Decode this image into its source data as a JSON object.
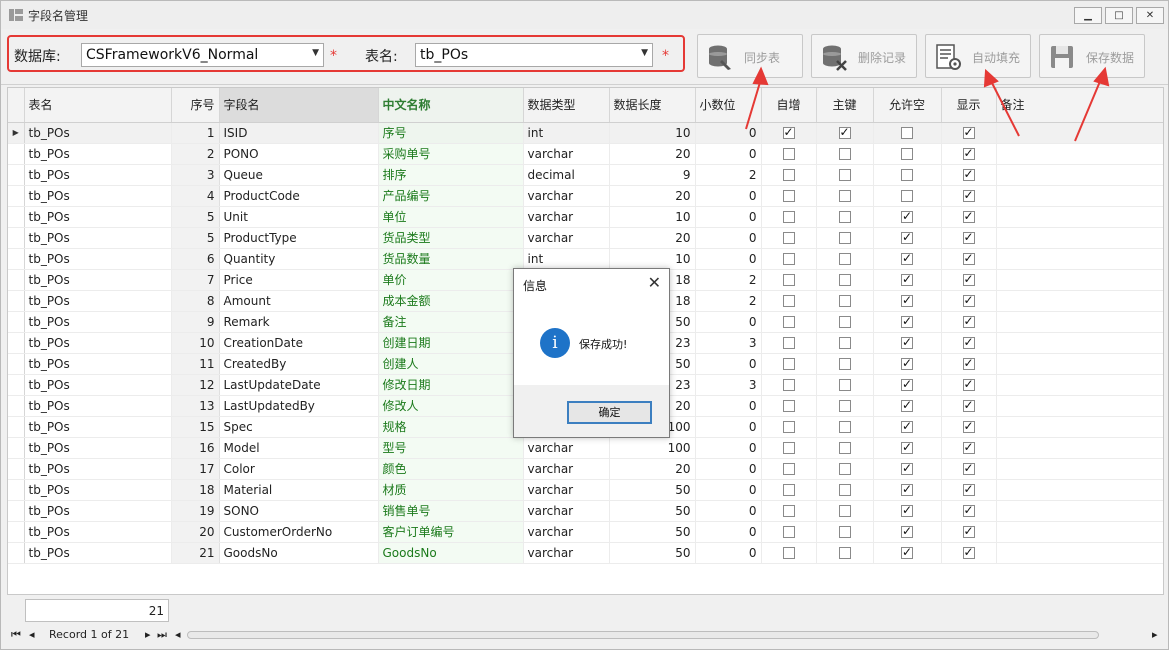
{
  "window": {
    "title": "字段名管理",
    "min_label": "▁",
    "max_label": "□",
    "close_label": "✕"
  },
  "toolbar": {
    "db_label": "数据库:",
    "db_value": "CSFrameworkV6_Normal",
    "table_label": "表名:",
    "table_value": "tb_POs",
    "required_mark": "*",
    "sync_label": "同步表",
    "delete_label": "删除记录",
    "autofill_label": "自动填充",
    "save_label": "保存数据"
  },
  "grid": {
    "headers": [
      "表名",
      "序号",
      "字段名",
      "中文名称",
      "数据类型",
      "数据长度",
      "小数位",
      "自增",
      "主键",
      "允许空",
      "显示",
      "备注"
    ],
    "rows": [
      {
        "table": "tb_POs",
        "no": 1,
        "field": "ISID",
        "cn": "序号",
        "type": "int",
        "len": 10,
        "dec": 0,
        "auto": true,
        "pk": true,
        "nullable": false,
        "show": true
      },
      {
        "table": "tb_POs",
        "no": 2,
        "field": "PONO",
        "cn": "采购单号",
        "type": "varchar",
        "len": 20,
        "dec": 0,
        "auto": false,
        "pk": false,
        "nullable": false,
        "show": true
      },
      {
        "table": "tb_POs",
        "no": 3,
        "field": "Queue",
        "cn": "排序",
        "type": "decimal",
        "len": 9,
        "dec": 2,
        "auto": false,
        "pk": false,
        "nullable": false,
        "show": true
      },
      {
        "table": "tb_POs",
        "no": 4,
        "field": "ProductCode",
        "cn": "产品编号",
        "type": "varchar",
        "len": 20,
        "dec": 0,
        "auto": false,
        "pk": false,
        "nullable": false,
        "show": true
      },
      {
        "table": "tb_POs",
        "no": 5,
        "field": "Unit",
        "cn": "单位",
        "type": "varchar",
        "len": 10,
        "dec": 0,
        "auto": false,
        "pk": false,
        "nullable": true,
        "show": true
      },
      {
        "table": "tb_POs",
        "no": 5,
        "field": "ProductType",
        "cn": "货品类型",
        "type": "varchar",
        "len": 20,
        "dec": 0,
        "auto": false,
        "pk": false,
        "nullable": true,
        "show": true
      },
      {
        "table": "tb_POs",
        "no": 6,
        "field": "Quantity",
        "cn": "货品数量",
        "type": "int",
        "len": 10,
        "dec": 0,
        "auto": false,
        "pk": false,
        "nullable": true,
        "show": true
      },
      {
        "table": "tb_POs",
        "no": 7,
        "field": "Price",
        "cn": "单价",
        "type": "",
        "len": 18,
        "dec": 2,
        "auto": false,
        "pk": false,
        "nullable": true,
        "show": true
      },
      {
        "table": "tb_POs",
        "no": 8,
        "field": "Amount",
        "cn": "成本金额",
        "type": "",
        "len": 18,
        "dec": 2,
        "auto": false,
        "pk": false,
        "nullable": true,
        "show": true
      },
      {
        "table": "tb_POs",
        "no": 9,
        "field": "Remark",
        "cn": "备注",
        "type": "",
        "len": 50,
        "dec": 0,
        "auto": false,
        "pk": false,
        "nullable": true,
        "show": true
      },
      {
        "table": "tb_POs",
        "no": 10,
        "field": "CreationDate",
        "cn": "创建日期",
        "type": "",
        "len": 23,
        "dec": 3,
        "auto": false,
        "pk": false,
        "nullable": true,
        "show": true
      },
      {
        "table": "tb_POs",
        "no": 11,
        "field": "CreatedBy",
        "cn": "创建人",
        "type": "",
        "len": 50,
        "dec": 0,
        "auto": false,
        "pk": false,
        "nullable": true,
        "show": true
      },
      {
        "table": "tb_POs",
        "no": 12,
        "field": "LastUpdateDate",
        "cn": "修改日期",
        "type": "",
        "len": 23,
        "dec": 3,
        "auto": false,
        "pk": false,
        "nullable": true,
        "show": true
      },
      {
        "table": "tb_POs",
        "no": 13,
        "field": "LastUpdatedBy",
        "cn": "修改人",
        "type": "",
        "len": 20,
        "dec": 0,
        "auto": false,
        "pk": false,
        "nullable": true,
        "show": true
      },
      {
        "table": "tb_POs",
        "no": 15,
        "field": "Spec",
        "cn": "规格",
        "type": "",
        "len": 100,
        "dec": 0,
        "auto": false,
        "pk": false,
        "nullable": true,
        "show": true
      },
      {
        "table": "tb_POs",
        "no": 16,
        "field": "Model",
        "cn": "型号",
        "type": "varchar",
        "len": 100,
        "dec": 0,
        "auto": false,
        "pk": false,
        "nullable": true,
        "show": true
      },
      {
        "table": "tb_POs",
        "no": 17,
        "field": "Color",
        "cn": "颜色",
        "type": "varchar",
        "len": 20,
        "dec": 0,
        "auto": false,
        "pk": false,
        "nullable": true,
        "show": true
      },
      {
        "table": "tb_POs",
        "no": 18,
        "field": "Material",
        "cn": "材质",
        "type": "varchar",
        "len": 50,
        "dec": 0,
        "auto": false,
        "pk": false,
        "nullable": true,
        "show": true
      },
      {
        "table": "tb_POs",
        "no": 19,
        "field": "SONO",
        "cn": "销售单号",
        "type": "varchar",
        "len": 50,
        "dec": 0,
        "auto": false,
        "pk": false,
        "nullable": true,
        "show": true
      },
      {
        "table": "tb_POs",
        "no": 20,
        "field": "CustomerOrderNo",
        "cn": "客户订单编号",
        "type": "varchar",
        "len": 50,
        "dec": 0,
        "auto": false,
        "pk": false,
        "nullable": true,
        "show": true
      },
      {
        "table": "tb_POs",
        "no": 21,
        "field": "GoodsNo",
        "cn": "GoodsNo",
        "type": "varchar",
        "len": 50,
        "dec": 0,
        "auto": false,
        "pk": false,
        "nullable": true,
        "show": true
      }
    ]
  },
  "footer": {
    "count": "21",
    "record_text": "Record 1 of 21"
  },
  "dialog": {
    "title": "信息",
    "close": "✕",
    "info_glyph": "i",
    "message": "保存成功!",
    "ok_label": "确定"
  },
  "colors": {
    "highlight_red": "#e53935",
    "chinese_name_green": "#1b7a1b",
    "info_blue": "#1e73c8"
  }
}
